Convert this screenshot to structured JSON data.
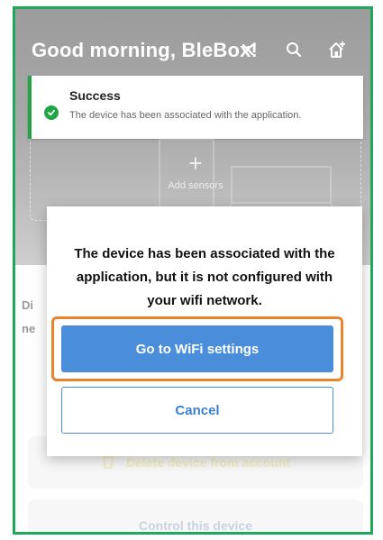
{
  "header": {
    "greeting": "Good morning, BleBox!",
    "icons": [
      "close-icon",
      "search-icon",
      "add-home-icon"
    ]
  },
  "toast": {
    "title": "Success",
    "message": "The device has been associated with the application."
  },
  "add_sensors": {
    "label": "Add sensors"
  },
  "background": {
    "text_line1": "Di",
    "text_line2": "ne",
    "delete_label": "Delete device from account",
    "control_label": "Control this device"
  },
  "dialog": {
    "message": "The device has been associated with the application, but it is not configured with your wifi network.",
    "primary_label": "Go to WiFi settings",
    "cancel_label": "Cancel"
  },
  "colors": {
    "frame": "#1fa85a",
    "success": "#22a545",
    "primary": "#4a8ddb",
    "highlight": "#e8842c"
  }
}
